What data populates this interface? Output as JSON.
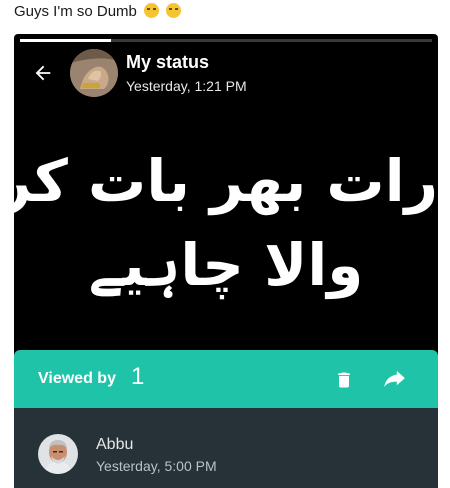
{
  "caption": {
    "text": "Guys I'm so Dumb",
    "emojis": [
      "grimacing-face-icon",
      "grimacing-face-icon"
    ]
  },
  "status_header": {
    "title": "My status",
    "time": "Yesterday, 1:21 PM",
    "back_icon": "arrow-left-icon",
    "avatar_icon": "profile-photo"
  },
  "status_post": {
    "line1": "رات بھر بات کرنے",
    "line2": "والا چاہیے",
    "background_color": "#000000",
    "text_color": "#ffffff"
  },
  "viewed_panel": {
    "label": "Viewed by",
    "count": "1",
    "accent_color": "#1fc3a8",
    "actions": [
      "trash-icon",
      "share-icon"
    ],
    "viewers": [
      {
        "name": "Abbu",
        "time": "Yesterday, 5:00 PM",
        "avatar_icon": "profile-photo"
      }
    ]
  }
}
